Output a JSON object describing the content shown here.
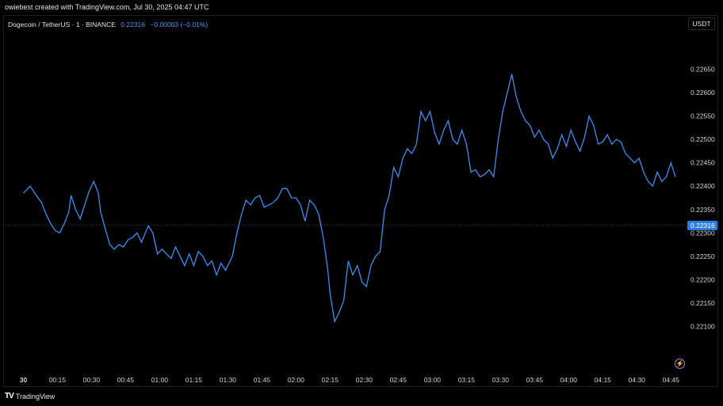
{
  "header": {
    "created_by": "owiebest created with TradingView.com, Jul 30, 2025 04:47 UTC"
  },
  "legend": {
    "symbol": "Dogecoin / TetherUS · 1 · BINANCE",
    "price": "0.22316",
    "change": "−0.00003 (−0.01%)"
  },
  "currency_label": "USDT",
  "last_price_label": "0.22316",
  "footer": {
    "brand": "TradingView",
    "logo": "TV"
  },
  "colors": {
    "line": "#3d8ef0",
    "price_tag": "#2a7de1",
    "background": "#000000"
  },
  "icons": {
    "bolt": "lightning-icon"
  },
  "chart_data": {
    "type": "line",
    "title": "",
    "xlabel": "",
    "ylabel": "",
    "x_ticks": [
      "30",
      "00:15",
      "00:30",
      "00:45",
      "01:00",
      "01:15",
      "01:30",
      "01:45",
      "02:00",
      "02:15",
      "02:30",
      "02:45",
      "03:00",
      "03:15",
      "03:30",
      "03:45",
      "04:00",
      "04:15",
      "04:30",
      "04:45"
    ],
    "y_ticks": [
      "0.22100",
      "0.22150",
      "0.22200",
      "0.22250",
      "0.22300",
      "0.22350",
      "0.22400",
      "0.22450",
      "0.22500",
      "0.22550",
      "0.22600",
      "0.22650"
    ],
    "ylim": [
      0.2207,
      0.2268
    ],
    "x_unit": "minutes since 00:00 (first tick labeled 30 = day)",
    "xlim": [
      -4,
      287
    ],
    "series": [
      {
        "values": [
          [
            0,
            0.22385
          ],
          [
            3,
            0.224
          ],
          [
            5,
            0.22385
          ],
          [
            8,
            0.22365
          ],
          [
            10,
            0.2234
          ],
          [
            12,
            0.2232
          ],
          [
            14,
            0.22305
          ],
          [
            16,
            0.223
          ],
          [
            18,
            0.2232
          ],
          [
            20,
            0.22345
          ],
          [
            21,
            0.2238
          ],
          [
            23,
            0.2235
          ],
          [
            25,
            0.2233
          ],
          [
            27,
            0.2236
          ],
          [
            29,
            0.2239
          ],
          [
            31,
            0.2241
          ],
          [
            33,
            0.22385
          ],
          [
            34,
            0.22345
          ],
          [
            36,
            0.2231
          ],
          [
            38,
            0.22275
          ],
          [
            40,
            0.22265
          ],
          [
            42,
            0.22275
          ],
          [
            44,
            0.2227
          ],
          [
            46,
            0.22285
          ],
          [
            48,
            0.2229
          ],
          [
            50,
            0.223
          ],
          [
            52,
            0.2228
          ],
          [
            55,
            0.22315
          ],
          [
            57,
            0.223
          ],
          [
            59,
            0.22255
          ],
          [
            61,
            0.22265
          ],
          [
            63,
            0.22255
          ],
          [
            65,
            0.22245
          ],
          [
            67,
            0.2227
          ],
          [
            69,
            0.2225
          ],
          [
            71,
            0.2223
          ],
          [
            73,
            0.22255
          ],
          [
            75,
            0.2223
          ],
          [
            77,
            0.2226
          ],
          [
            79,
            0.2225
          ],
          [
            81,
            0.2223
          ],
          [
            83,
            0.2224
          ],
          [
            85,
            0.2221
          ],
          [
            87,
            0.22235
          ],
          [
            89,
            0.2222
          ],
          [
            92,
            0.2225
          ],
          [
            94,
            0.223
          ],
          [
            96,
            0.2234
          ],
          [
            98,
            0.2237
          ],
          [
            100,
            0.2236
          ],
          [
            102,
            0.22375
          ],
          [
            104,
            0.2238
          ],
          [
            106,
            0.22355
          ],
          [
            108,
            0.2236
          ],
          [
            110,
            0.22365
          ],
          [
            112,
            0.22375
          ],
          [
            114,
            0.22395
          ],
          [
            116,
            0.22395
          ],
          [
            118,
            0.22375
          ],
          [
            120,
            0.22375
          ],
          [
            122,
            0.2236
          ],
          [
            124,
            0.22325
          ],
          [
            126,
            0.2237
          ],
          [
            128,
            0.2236
          ],
          [
            130,
            0.2234
          ],
          [
            132,
            0.2229
          ],
          [
            134,
            0.2222
          ],
          [
            135,
            0.2217
          ],
          [
            137,
            0.2211
          ],
          [
            139,
            0.2213
          ],
          [
            141,
            0.22155
          ],
          [
            143,
            0.2224
          ],
          [
            145,
            0.2221
          ],
          [
            147,
            0.2223
          ],
          [
            149,
            0.22195
          ],
          [
            151,
            0.22185
          ],
          [
            153,
            0.2223
          ],
          [
            155,
            0.2225
          ],
          [
            157,
            0.2226
          ],
          [
            159,
            0.2235
          ],
          [
            161,
            0.2238
          ],
          [
            163,
            0.2244
          ],
          [
            165,
            0.2242
          ],
          [
            167,
            0.2246
          ],
          [
            169,
            0.2248
          ],
          [
            171,
            0.2247
          ],
          [
            173,
            0.2249
          ],
          [
            175,
            0.2256
          ],
          [
            177,
            0.2254
          ],
          [
            179,
            0.2256
          ],
          [
            181,
            0.22515
          ],
          [
            183,
            0.2249
          ],
          [
            185,
            0.2252
          ],
          [
            187,
            0.2254
          ],
          [
            189,
            0.225
          ],
          [
            191,
            0.2249
          ],
          [
            193,
            0.2252
          ],
          [
            195,
            0.2249
          ],
          [
            197,
            0.2243
          ],
          [
            199,
            0.22435
          ],
          [
            201,
            0.2242
          ],
          [
            203,
            0.22425
          ],
          [
            205,
            0.22435
          ],
          [
            207,
            0.2242
          ],
          [
            209,
            0.225
          ],
          [
            211,
            0.2256
          ],
          [
            213,
            0.226
          ],
          [
            215,
            0.2264
          ],
          [
            217,
            0.2259
          ],
          [
            219,
            0.2256
          ],
          [
            221,
            0.2254
          ],
          [
            223,
            0.2253
          ],
          [
            225,
            0.22505
          ],
          [
            227,
            0.2252
          ],
          [
            229,
            0.225
          ],
          [
            231,
            0.2249
          ],
          [
            233,
            0.2246
          ],
          [
            235,
            0.2248
          ],
          [
            237,
            0.2251
          ],
          [
            239,
            0.22485
          ],
          [
            241,
            0.2252
          ],
          [
            243,
            0.22495
          ],
          [
            245,
            0.22475
          ],
          [
            247,
            0.22505
          ],
          [
            249,
            0.2255
          ],
          [
            251,
            0.2253
          ],
          [
            253,
            0.2249
          ],
          [
            255,
            0.22495
          ],
          [
            257,
            0.2251
          ],
          [
            259,
            0.2249
          ],
          [
            261,
            0.225
          ],
          [
            263,
            0.22495
          ],
          [
            265,
            0.2247
          ],
          [
            267,
            0.2246
          ],
          [
            269,
            0.2245
          ],
          [
            271,
            0.2246
          ],
          [
            273,
            0.2243
          ],
          [
            275,
            0.2241
          ],
          [
            277,
            0.224
          ],
          [
            279,
            0.2243
          ],
          [
            281,
            0.2241
          ],
          [
            283,
            0.2242
          ],
          [
            285,
            0.2245
          ],
          [
            287,
            0.2242
          ]
        ]
      }
    ]
  }
}
